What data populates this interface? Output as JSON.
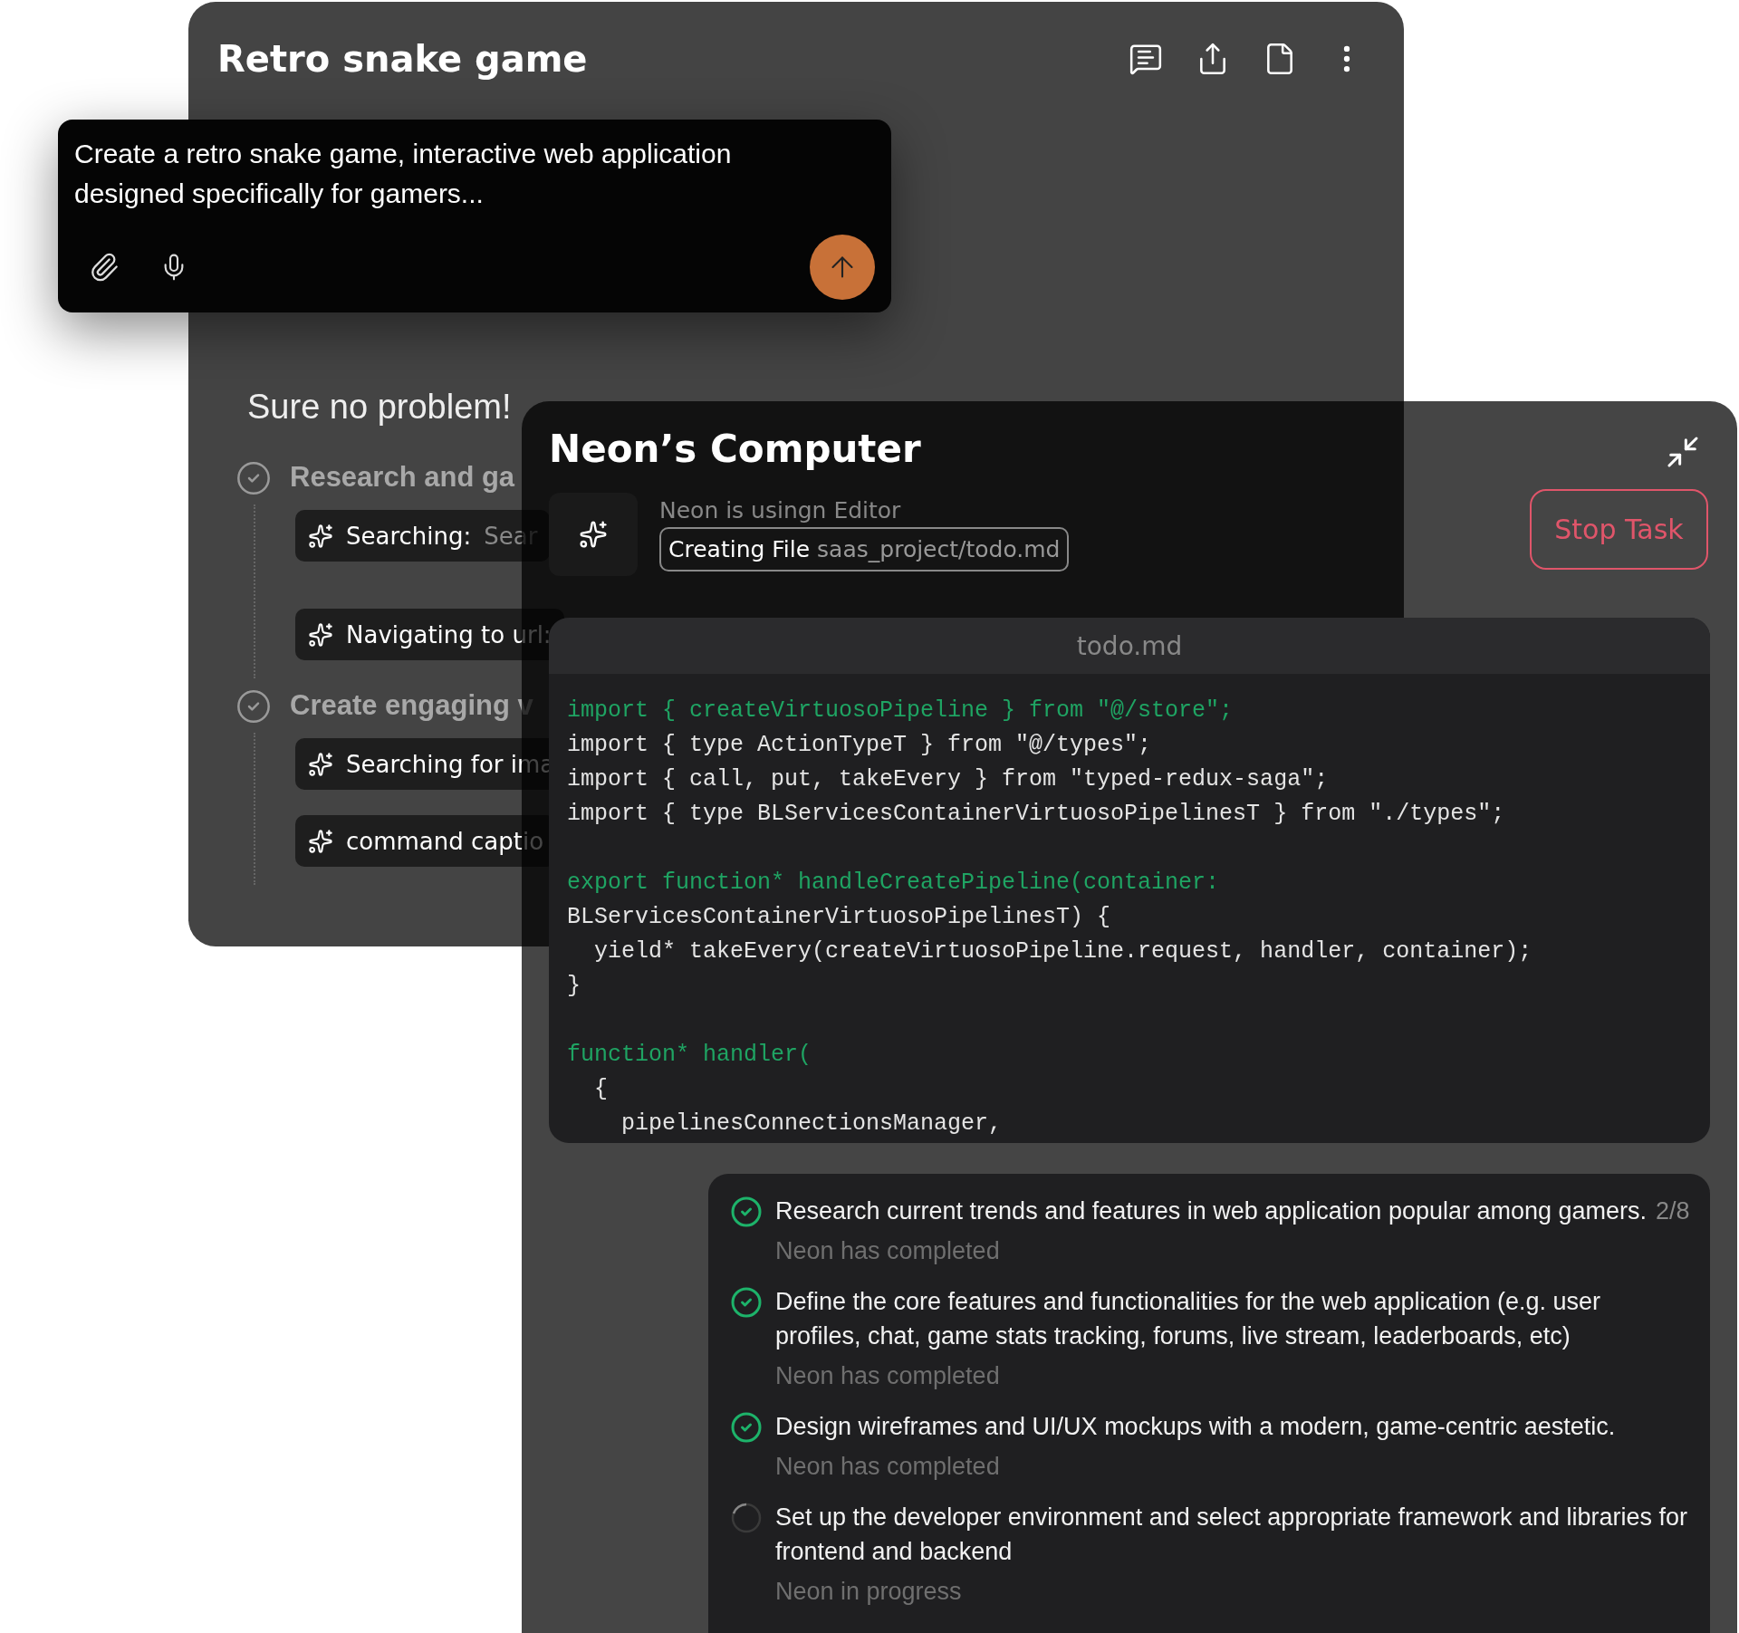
{
  "chat_window": {
    "title": "Retro snake game",
    "prompt": {
      "text": "Create a retro snake game, interactive web application designed specifically for gamers..."
    },
    "reply": "Sure no problem!",
    "steps": [
      {
        "title": "Research and ga",
        "done": true,
        "actions": [
          {
            "label": "Searching:",
            "detail": "Sear"
          },
          {
            "label": "Navigating to url:"
          }
        ]
      },
      {
        "title": "Create engaging v",
        "done": true,
        "actions": [
          {
            "label": "Searching for ima"
          },
          {
            "label": "command captio"
          }
        ]
      }
    ]
  },
  "computer_panel": {
    "title": "Neon’s Computer",
    "stop_button": "Stop Task",
    "activity": {
      "caption": "Neon is usingn Editor",
      "action": "Creating File",
      "path": "saas_project/todo.md"
    },
    "editor": {
      "filename": "todo.md",
      "blocks": [
        [
          {
            "text": "import { createVirtuosoPipeline } from \"@/store\";",
            "highlight": true
          },
          {
            "text": "import { type ActionTypeT } from \"@/types\";",
            "highlight": false
          },
          {
            "text": "import { call, put, takeEvery } from \"typed-redux-saga\";",
            "highlight": false
          },
          {
            "text": "import { type BLServicesContainerVirtuosoPipelinesT } from \"./types\";",
            "highlight": false
          }
        ],
        [
          {
            "text": "export function* handleCreatePipeline(container:",
            "highlight": true
          },
          {
            "text": "BLServicesContainerVirtuosoPipelinesT) {",
            "highlight": false
          },
          {
            "text": "  yield* takeEvery(createVirtuosoPipeline.request, handler, container);",
            "highlight": false
          },
          {
            "text": "}",
            "highlight": false
          }
        ],
        [
          {
            "text": "function* handler(",
            "highlight": true
          },
          {
            "text": "  {",
            "highlight": false
          },
          {
            "text": "    pipelinesConnectionsManager,",
            "highlight": false
          }
        ]
      ]
    },
    "tasks": [
      {
        "title": "Research current trends and features in web application popular among gamers.",
        "counter": "2/8",
        "done": true,
        "status_text": "Neon has completed"
      },
      {
        "title": "Define the core features and functionalities for the web application (e.g. user profiles, chat, game stats tracking, forums, live stream, leaderboards, etc)",
        "done": true,
        "status_text": "Neon has completed"
      },
      {
        "title": "Design wireframes and UI/UX mockups with a modern, game-centric aestetic.",
        "done": true,
        "status_text": "Neon has completed"
      },
      {
        "title": "Set up the developer environment and select appropriate framework and libraries for frontend and backend",
        "done": false,
        "status_text": "Neon in progress"
      }
    ]
  }
}
